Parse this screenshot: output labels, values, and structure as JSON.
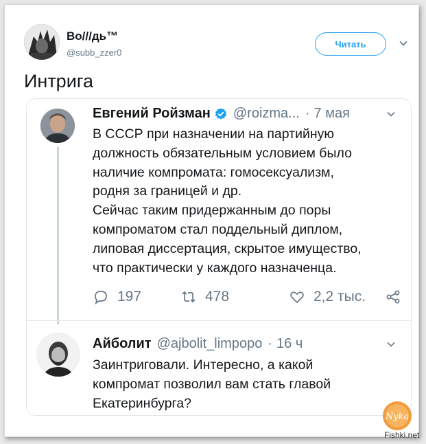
{
  "header": {
    "author_name": "Во///дь™",
    "author_handle": "@subb_zzer0",
    "follow_label": "Читать"
  },
  "tweet": {
    "text": "Интрига"
  },
  "quoted": {
    "name": "Евгений Ройзман",
    "handle": "@roizma...",
    "dot": "·",
    "time": "7 мая",
    "body_lines": [
      "В СССР при назначении на партийную",
      "должность обязательным условием было",
      "наличие компромата: гомосексуализм,",
      "родня за границей и др.",
      "Сейчас таким придержанным до поры",
      "компроматом стал поддельный диплом,",
      "липовая диссертация, скрытое имущество,",
      "что практически у каждого назначенца."
    ],
    "actions": {
      "reply_count": "197",
      "retweet_count": "478",
      "like_count": "2,2 тыс."
    }
  },
  "reply": {
    "name": "Айболит",
    "handle": "@ajbolit_limpopo",
    "dot": "·",
    "time": "16 ч",
    "body_lines": [
      "Заинтриговали. Интересно, а какой",
      "компромат позволил вам стать главой",
      "Екатеринбурга?"
    ]
  },
  "watermark": {
    "logo_text": "Nyka",
    "site": "Fishki.net"
  },
  "colors": {
    "accent": "#1da1f2",
    "text": "#14171a",
    "secondary": "#657786",
    "border": "#e1e8ed"
  }
}
